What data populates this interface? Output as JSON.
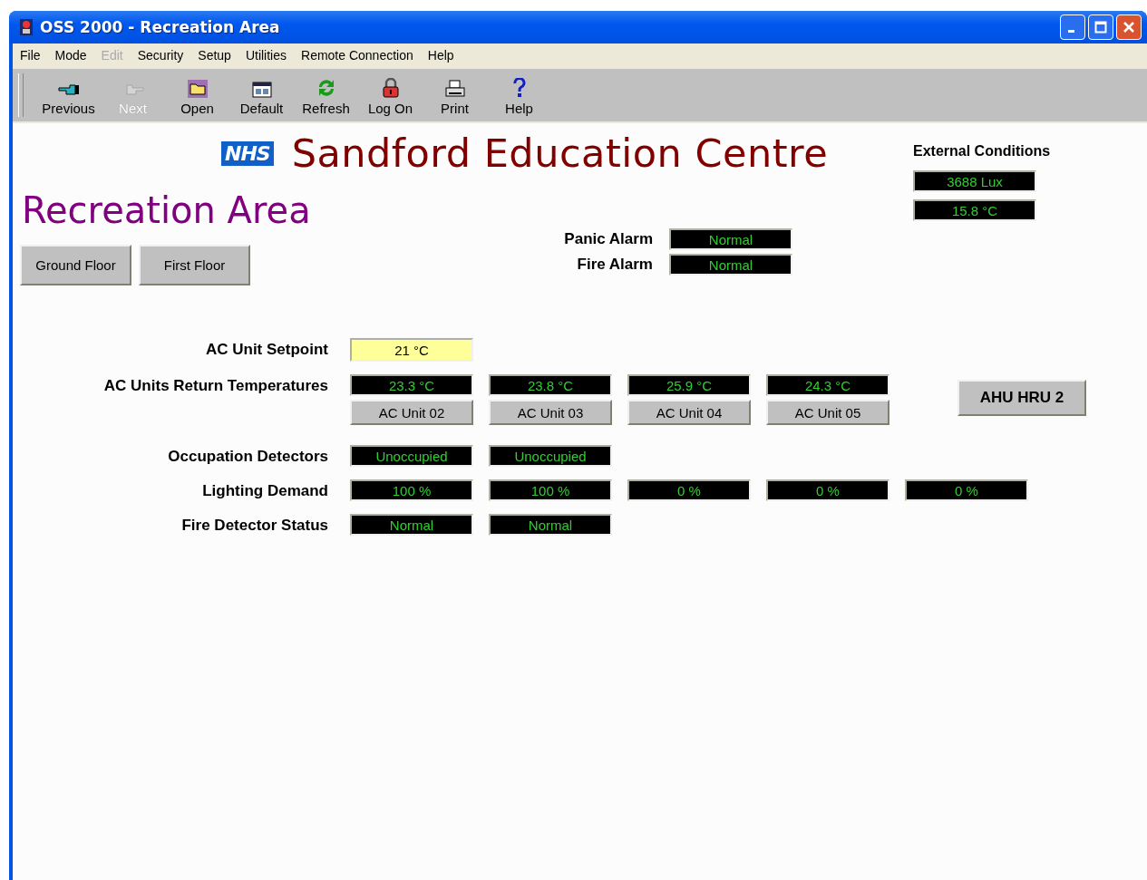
{
  "window": {
    "title": "OSS 2000 - Recreation Area"
  },
  "menu": [
    {
      "label": "File",
      "disabled": false
    },
    {
      "label": "Mode",
      "disabled": false
    },
    {
      "label": "Edit",
      "disabled": true
    },
    {
      "label": "Security",
      "disabled": false
    },
    {
      "label": "Setup",
      "disabled": false
    },
    {
      "label": "Utilities",
      "disabled": false
    },
    {
      "label": "Remote Connection",
      "disabled": false
    },
    {
      "label": "Help",
      "disabled": false
    }
  ],
  "toolbar": [
    {
      "label": "Previous",
      "disabled": false
    },
    {
      "label": "Next",
      "disabled": true
    },
    {
      "label": "Open",
      "disabled": false
    },
    {
      "label": "Default",
      "disabled": false
    },
    {
      "label": "Refresh",
      "disabled": false
    },
    {
      "label": "Log On",
      "disabled": false
    },
    {
      "label": "Print",
      "disabled": false
    },
    {
      "label": "Help",
      "disabled": false
    }
  ],
  "header": {
    "logo": "NHS",
    "title": "Sandford Education Centre"
  },
  "area_title": "Recreation Area",
  "floor_buttons": [
    "Ground Floor",
    "First Floor"
  ],
  "alarms": [
    {
      "label": "Panic Alarm",
      "value": "Normal"
    },
    {
      "label": "Fire Alarm",
      "value": "Normal"
    }
  ],
  "external_conditions": {
    "title": "External Conditions",
    "readings": [
      "3688 Lux",
      "15.8 °C"
    ]
  },
  "setpoint": {
    "label": "AC Unit Setpoint",
    "value": "21 °C"
  },
  "return_temperatures": {
    "label": "AC Units Return Temperatures",
    "units": [
      {
        "value": "23.3 °C",
        "name": "AC Unit 02"
      },
      {
        "value": "23.8 °C",
        "name": "AC Unit 03"
      },
      {
        "value": "25.9 °C",
        "name": "AC Unit 04"
      },
      {
        "value": "24.3 °C",
        "name": "AC Unit 05"
      }
    ]
  },
  "ahu_button": "AHU HRU 2",
  "status_rows": [
    {
      "label": "Occupation Detectors",
      "values": [
        "Unoccupied",
        "Unoccupied"
      ]
    },
    {
      "label": "Lighting Demand",
      "values": [
        "100 %",
        "100 %",
        "0 %",
        "0 %",
        "0 %"
      ]
    },
    {
      "label": "Fire Detector Status",
      "values": [
        "Normal",
        "Normal"
      ]
    }
  ]
}
